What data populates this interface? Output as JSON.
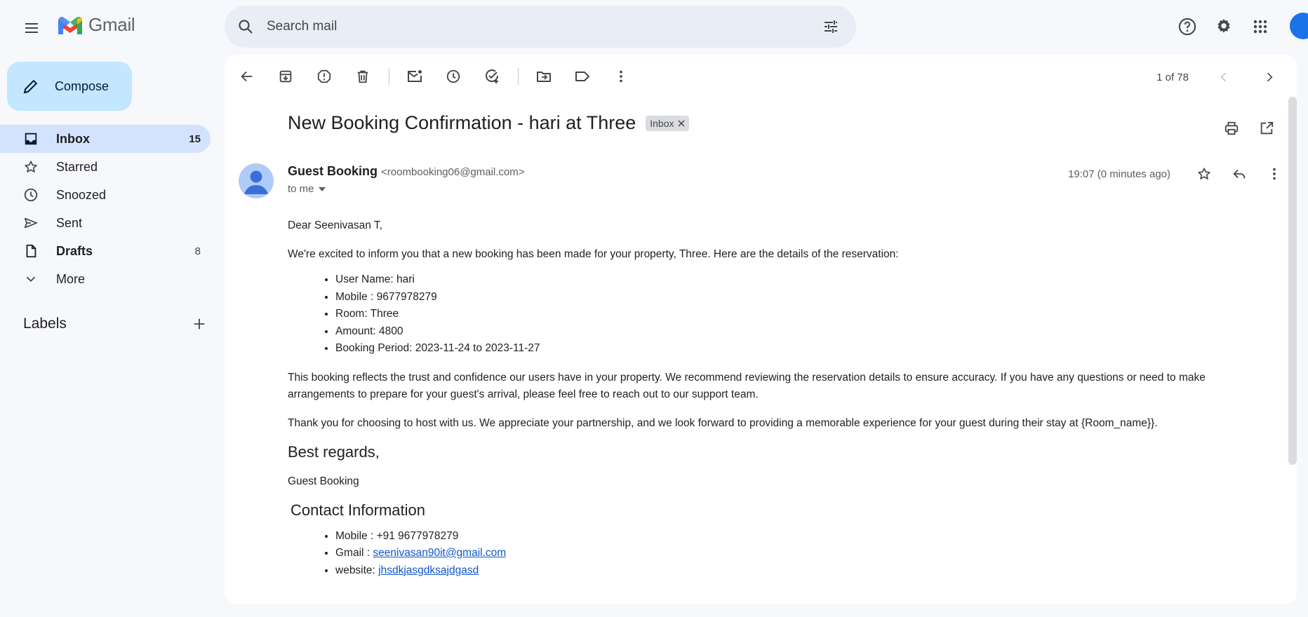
{
  "app": {
    "name": "Gmail"
  },
  "search": {
    "placeholder": "Search mail"
  },
  "compose": {
    "label": "Compose"
  },
  "sidebar": {
    "items": [
      {
        "label": "Inbox",
        "count": "15"
      },
      {
        "label": "Starred",
        "count": ""
      },
      {
        "label": "Snoozed",
        "count": ""
      },
      {
        "label": "Sent",
        "count": ""
      },
      {
        "label": "Drafts",
        "count": "8"
      },
      {
        "label": "More",
        "count": ""
      }
    ],
    "labels_title": "Labels"
  },
  "pager": {
    "text": "1 of 78"
  },
  "message": {
    "subject": "New Booking Confirmation - hari at Three",
    "chip": "Inbox",
    "sender_name": "Guest Booking",
    "sender_email": "<roombooking06@gmail.com>",
    "to": "to me",
    "time": "19:07 (0 minutes ago)",
    "greeting": "Dear Seenivasan T,",
    "intro": "We're excited to inform you that a new booking has been made for your property, Three. Here are the details of the reservation:",
    "details": [
      "User Name: hari",
      "Mobile : 9677978279",
      "Room: Three",
      "Amount: 4800",
      "Booking Period: 2023-11-24 to 2023-11-27"
    ],
    "para1": "This booking reflects the trust and confidence our users have in your property. We recommend reviewing the reservation details to ensure accuracy. If you have any questions or need to make arrangements to prepare for your guest's arrival, please feel free to reach out to our support team.",
    "para2": "Thank you for choosing to host with us. We appreciate your partnership, and we look forward to providing a memorable experience for your guest during their stay at {Room_name}}.",
    "regards": "Best regards,",
    "signature": "Guest Booking",
    "contact_heading": "Contact Information",
    "contact": {
      "mobile": "Mobile : +91 9677978279",
      "gmail_label": "Gmail : ",
      "gmail_link": "seenivasan90it@gmail.com",
      "website_label": "website: ",
      "website_link": "jhsdkjasgdksajdgasd"
    }
  },
  "colors": {
    "background": "#f6f8fc",
    "compose": "#c2e7ff",
    "active_nav": "#d3e3fd",
    "search": "#e9eef6",
    "link": "#1155cc"
  }
}
